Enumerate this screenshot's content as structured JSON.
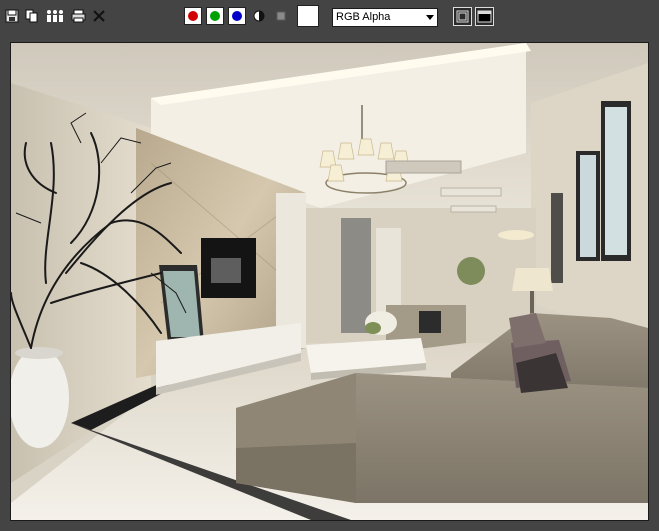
{
  "toolbar": {
    "icons": [
      "save-icon",
      "copy-icon",
      "clone-icon",
      "print-icon",
      "clear-icon"
    ],
    "channels": [
      {
        "name": "red-channel",
        "color": "#d00000"
      },
      {
        "name": "green-channel",
        "color": "#00a000"
      },
      {
        "name": "blue-channel",
        "color": "#0000c8"
      }
    ],
    "swatch_color": "#ffffff",
    "channel_select": {
      "value": "RGB Alpha"
    }
  },
  "render": {
    "description_icon": "rendered-image"
  }
}
